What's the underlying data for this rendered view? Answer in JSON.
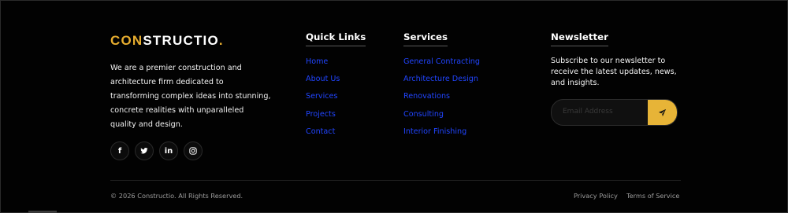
{
  "brand": {
    "part1": "CON",
    "part2": "STRUCTIO",
    "dot": "."
  },
  "about": "We are a premier construction and architecture firm dedicated to transforming complex ideas into stunning, concrete realities with unparalleled quality and design.",
  "social": [
    {
      "icon": "facebook-icon",
      "glyph": "f"
    },
    {
      "icon": "twitter-icon",
      "glyph": "t"
    },
    {
      "icon": "linkedin-icon",
      "glyph": "in"
    },
    {
      "icon": "instagram-icon",
      "glyph": "ig"
    }
  ],
  "quick_links": {
    "title": "Quick Links",
    "items": [
      "Home",
      "About Us",
      "Services",
      "Projects",
      "Contact"
    ]
  },
  "services": {
    "title": "Services",
    "items": [
      "General Contracting",
      "Architecture Design",
      "Renovations",
      "Consulting",
      "Interior Finishing"
    ]
  },
  "newsletter": {
    "title": "Newsletter",
    "text": "Subscribe to our newsletter to receive the latest updates, news, and insights.",
    "placeholder": "Email Address",
    "submit_icon": "send-icon"
  },
  "footer": {
    "copyright": "© 2026 Constructio. All Rights Reserved.",
    "privacy": "Privacy Policy",
    "terms": "Terms of Service"
  },
  "colors": {
    "accent": "#e7ad2f",
    "link": "#2145ff",
    "background": "#020202"
  }
}
